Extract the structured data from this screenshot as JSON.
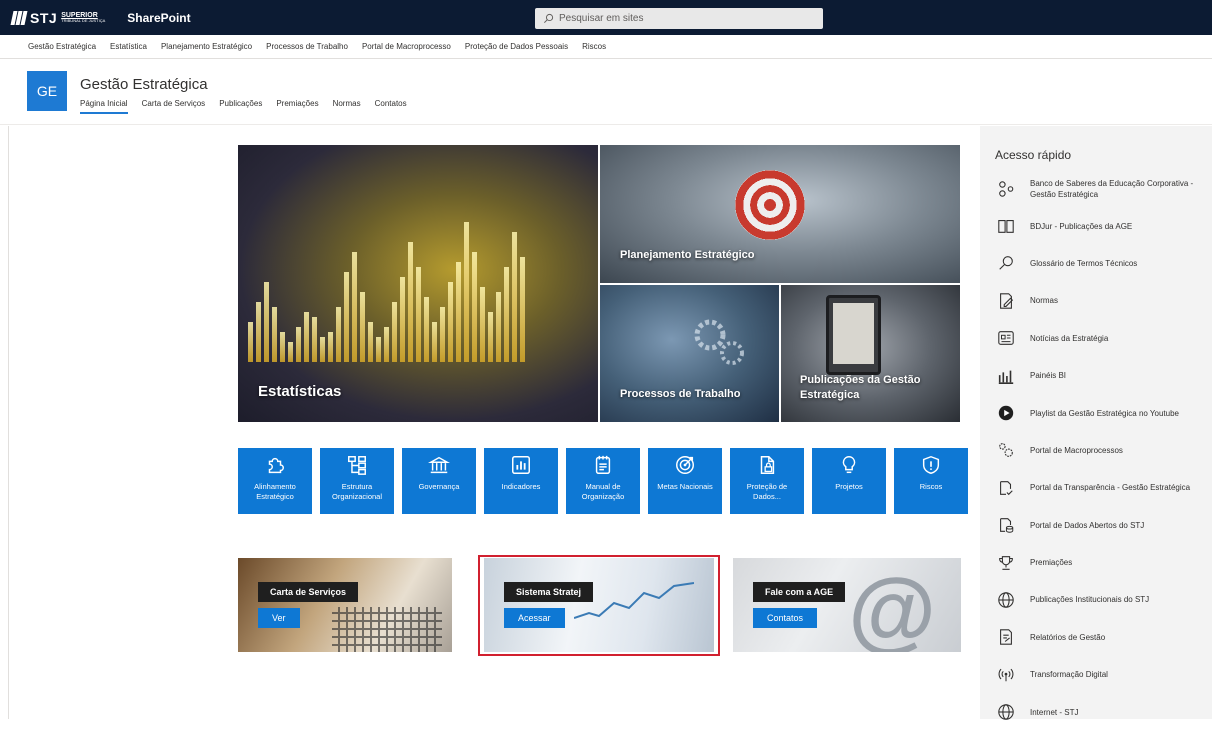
{
  "suite": {
    "brand": "STJ",
    "brand_sub1": "SUPERIOR",
    "brand_sub2": "TRIBUNAL DE JUSTIÇA",
    "app": "SharePoint",
    "search_placeholder": "Pesquisar em sites"
  },
  "hub_nav": [
    "Gestão Estratégica",
    "Estatística",
    "Planejamento Estratégico",
    "Processos de Trabalho",
    "Portal de Macroprocesso",
    "Proteção de Dados Pessoais",
    "Riscos"
  ],
  "site": {
    "logo": "GE",
    "title": "Gestão Estratégica",
    "nav": [
      "Página Inicial",
      "Carta de Serviços",
      "Publicações",
      "Premiações",
      "Normas",
      "Contatos"
    ],
    "active_nav": "Página Inicial"
  },
  "hero": {
    "stats": "Estatísticas",
    "plan": "Planejamento Estratégico",
    "proc": "Processos de Trabalho",
    "pub": "Publicações da Gestão Estratégica"
  },
  "tiles": [
    {
      "label": "Alinhamento Estratégico",
      "icon": "puzzle-icon"
    },
    {
      "label": "Estrutura Organizacional",
      "icon": "org-chart-icon"
    },
    {
      "label": "Governança",
      "icon": "bank-icon"
    },
    {
      "label": "Indicadores",
      "icon": "bar-chart-icon"
    },
    {
      "label": "Manual de Organização",
      "icon": "notepad-icon"
    },
    {
      "label": "Metas Nacionais",
      "icon": "target-icon"
    },
    {
      "label": "Proteção de Dados...",
      "icon": "document-lock-icon"
    },
    {
      "label": "Projetos",
      "icon": "lightbulb-icon"
    },
    {
      "label": "Riscos",
      "icon": "shield-alert-icon"
    }
  ],
  "cards": {
    "carta": {
      "title": "Carta de Serviços",
      "button": "Ver"
    },
    "stratej": {
      "title": "Sistema Stratej",
      "button": "Acessar"
    },
    "contato": {
      "title": "Fale com a AGE",
      "button": "Contatos"
    }
  },
  "quick_links": {
    "title": "Acesso rápido",
    "items": [
      {
        "label": "Banco de Saberes da Educação Corporativa - Gestão Estratégica",
        "icon": "nodes-icon"
      },
      {
        "label": "BDJur - Publicações da AGE",
        "icon": "book-icon"
      },
      {
        "label": "Glossário de Termos Técnicos",
        "icon": "search-icon"
      },
      {
        "label": "Normas",
        "icon": "edit-document-icon"
      },
      {
        "label": "Notícias da Estratégia",
        "icon": "news-icon"
      },
      {
        "label": "Painéis BI",
        "icon": "chart-icon"
      },
      {
        "label": "Playlist da Gestão Estratégica no Youtube",
        "icon": "play-icon"
      },
      {
        "label": "Portal de Macroprocessos",
        "icon": "gears-icon"
      },
      {
        "label": "Portal da Transparência - Gestão Estratégica",
        "icon": "document-check-icon"
      },
      {
        "label": "Portal de Dados Abertos do STJ",
        "icon": "database-doc-icon"
      },
      {
        "label": "Premiações",
        "icon": "trophy-icon"
      },
      {
        "label": "Publicações Institucionais do STJ",
        "icon": "globe-icon"
      },
      {
        "label": "Relatórios de Gestão",
        "icon": "report-icon"
      },
      {
        "label": "Transformação Digital",
        "icon": "broadcast-icon"
      },
      {
        "label": "Internet - STJ",
        "icon": "globe-icon"
      }
    ]
  },
  "colors": {
    "suite_bar": "#0c1b33",
    "accent": "#0e78d4",
    "highlight_frame": "#d1202f",
    "sidebar_bg": "#f3f3f3"
  }
}
